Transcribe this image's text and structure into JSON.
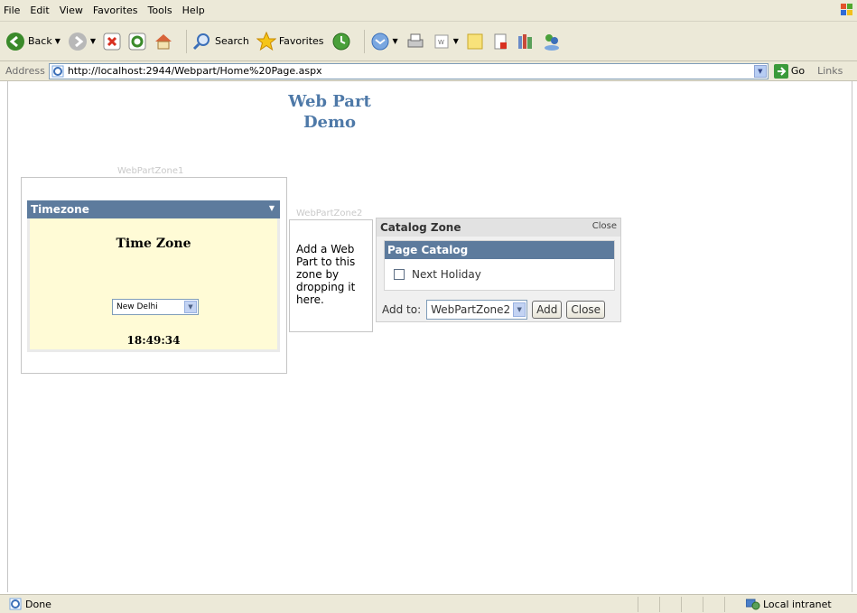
{
  "menu": [
    "File",
    "Edit",
    "View",
    "Favorites",
    "Tools",
    "Help"
  ],
  "toolbar": {
    "back": "Back",
    "search": "Search",
    "favorites": "Favorites"
  },
  "address": {
    "label": "Address",
    "url": "http://localhost:2944/Webpart/Home%20Page.aspx",
    "go": "Go",
    "links": "Links"
  },
  "page": {
    "heading_line1": "Web Part",
    "heading_line2": "Demo"
  },
  "zone1": {
    "title": "WebPartZone1",
    "webpart_title": "Timezone",
    "heading": "Time Zone",
    "selected_city": "New Delhi",
    "time": "18:49:34"
  },
  "zone2": {
    "title": "WebPartZone2",
    "empty_text": "Add a Web Part to this zone by dropping it here."
  },
  "catalog": {
    "title": "Catalog Zone",
    "close_link": "Close",
    "catalog_title": "Page Catalog",
    "item": "Next Holiday",
    "add_to_label": "Add to:",
    "add_to_value": "WebPartZone2",
    "add_button": "Add",
    "close_button": "Close"
  },
  "status": {
    "text": "Done",
    "zone": "Local intranet"
  }
}
